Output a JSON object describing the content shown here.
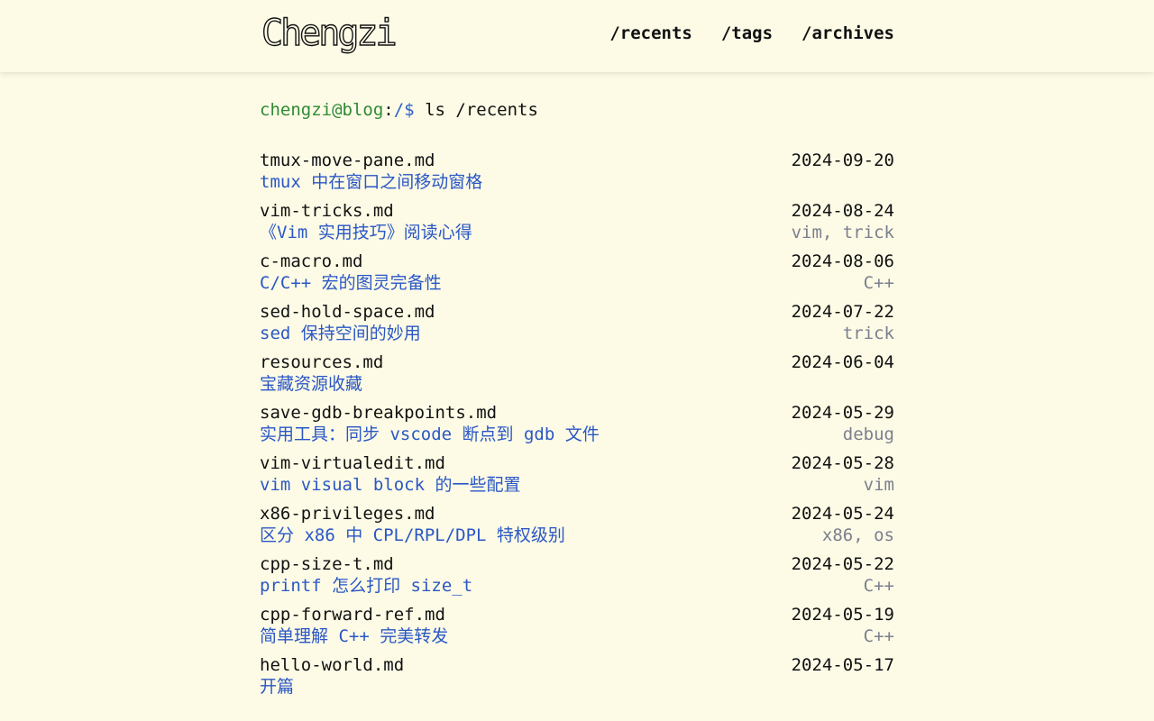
{
  "header": {
    "logo_text": "Chengzi",
    "nav": [
      {
        "label": "/recents"
      },
      {
        "label": "/tags"
      },
      {
        "label": "/archives"
      }
    ]
  },
  "prompt": {
    "user": "chengzi@blog",
    "colon": ":",
    "path": "/$",
    "command": " ls /recents"
  },
  "posts": [
    {
      "file": "tmux-move-pane.md",
      "date": "2024-09-20",
      "title": "tmux 中在窗口之间移动窗格",
      "tags": ""
    },
    {
      "file": "vim-tricks.md",
      "date": "2024-08-24",
      "title": "《Vim 实用技巧》阅读心得",
      "tags": "vim, trick"
    },
    {
      "file": "c-macro.md",
      "date": "2024-08-06",
      "title": "C/C++ 宏的图灵完备性",
      "tags": "C++"
    },
    {
      "file": "sed-hold-space.md",
      "date": "2024-07-22",
      "title": "sed 保持空间的妙用",
      "tags": "trick"
    },
    {
      "file": "resources.md",
      "date": "2024-06-04",
      "title": "宝藏资源收藏",
      "tags": ""
    },
    {
      "file": "save-gdb-breakpoints.md",
      "date": "2024-05-29",
      "title": "实用工具：同步 vscode 断点到 gdb 文件",
      "tags": "debug"
    },
    {
      "file": "vim-virtualedit.md",
      "date": "2024-05-28",
      "title": "vim visual block 的一些配置",
      "tags": "vim"
    },
    {
      "file": "x86-privileges.md",
      "date": "2024-05-24",
      "title": "区分 x86 中 CPL/RPL/DPL 特权级别",
      "tags": "x86, os"
    },
    {
      "file": "cpp-size-t.md",
      "date": "2024-05-22",
      "title": "printf 怎么打印 size_t",
      "tags": "C++"
    },
    {
      "file": "cpp-forward-ref.md",
      "date": "2024-05-19",
      "title": "简单理解 C++ 完美转发",
      "tags": "C++"
    },
    {
      "file": "hello-world.md",
      "date": "2024-05-17",
      "title": "开篇",
      "tags": ""
    }
  ]
}
